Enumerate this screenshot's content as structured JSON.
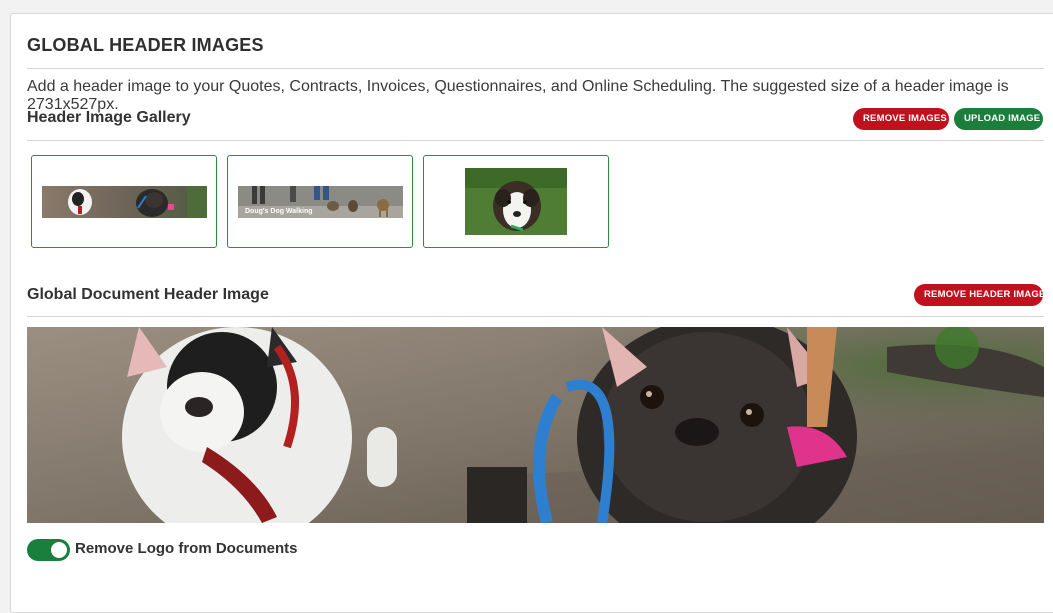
{
  "header": {
    "title": "GLOBAL HEADER IMAGES",
    "description": "Add a header image to your Quotes, Contracts, Invoices, Questionnaires, and Online Scheduling. The suggested size of a header image is 2731x527px."
  },
  "gallery": {
    "title": "Header Image Gallery",
    "remove_label": "REMOVE IMAGES",
    "upload_label": "UPLOAD IMAGE",
    "thumbnails": [
      {
        "name": "thumbnail-dogs-banner",
        "caption": ""
      },
      {
        "name": "thumbnail-dog-walking-banner",
        "caption": "Doug's Dog Walking"
      },
      {
        "name": "thumbnail-puppy-photo",
        "caption": ""
      }
    ]
  },
  "document_header": {
    "title": "Global Document Header Image",
    "remove_label": "REMOVE HEADER IMAGE"
  },
  "logo_toggle": {
    "label": "Remove Logo from Documents",
    "checked": true
  },
  "colors": {
    "danger": "#c0111f",
    "success": "#1a7f3c",
    "thumb_border": "#2e8b3d"
  }
}
